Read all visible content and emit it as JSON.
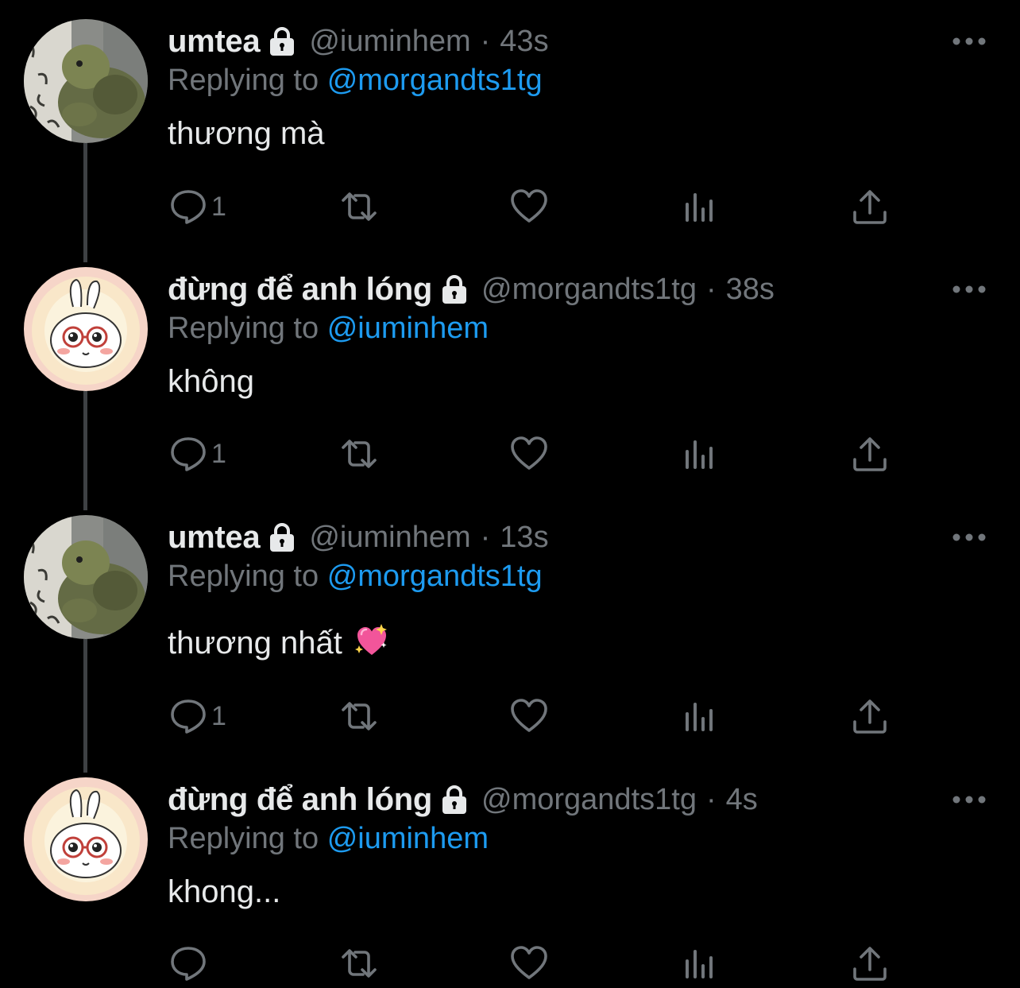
{
  "colors": {
    "background": "#000000",
    "text_primary": "#e7e9ea",
    "text_secondary": "#71767b",
    "link": "#1d9bf0",
    "thread_line": "#3e4144"
  },
  "tweets": [
    {
      "display_name": "umtea",
      "handle": "@iuminhem",
      "separator": "·",
      "time": "43s",
      "replying_label": "Replying to",
      "replying_to": "@morgandts1tg",
      "text": "thương mà",
      "reply_count": "1",
      "avatar": "turtle-plush-avatar"
    },
    {
      "display_name": "đừng để anh lóng",
      "handle": "@morgandts1tg",
      "separator": "·",
      "time": "38s",
      "replying_label": "Replying to",
      "replying_to": "@iuminhem",
      "text": "không",
      "reply_count": "1",
      "avatar": "bunny-glasses-avatar"
    },
    {
      "display_name": "umtea",
      "handle": "@iuminhem",
      "separator": "·",
      "time": "13s",
      "replying_label": "Replying to",
      "replying_to": "@morgandts1tg",
      "text": "thương nhất",
      "emoji": "sparkling-heart-emoji",
      "reply_count": "1",
      "avatar": "turtle-plush-avatar"
    },
    {
      "display_name": "đừng để anh lóng",
      "handle": "@morgandts1tg",
      "separator": "·",
      "time": "4s",
      "replying_label": "Replying to",
      "replying_to": "@iuminhem",
      "text": "khong...",
      "reply_count": "",
      "avatar": "bunny-glasses-avatar"
    }
  ],
  "icons": {
    "protected": "lock-icon",
    "more": "more-icon",
    "reply": "reply-icon",
    "retweet": "retweet-icon",
    "like": "heart-icon",
    "views": "views-icon",
    "share": "share-icon"
  }
}
